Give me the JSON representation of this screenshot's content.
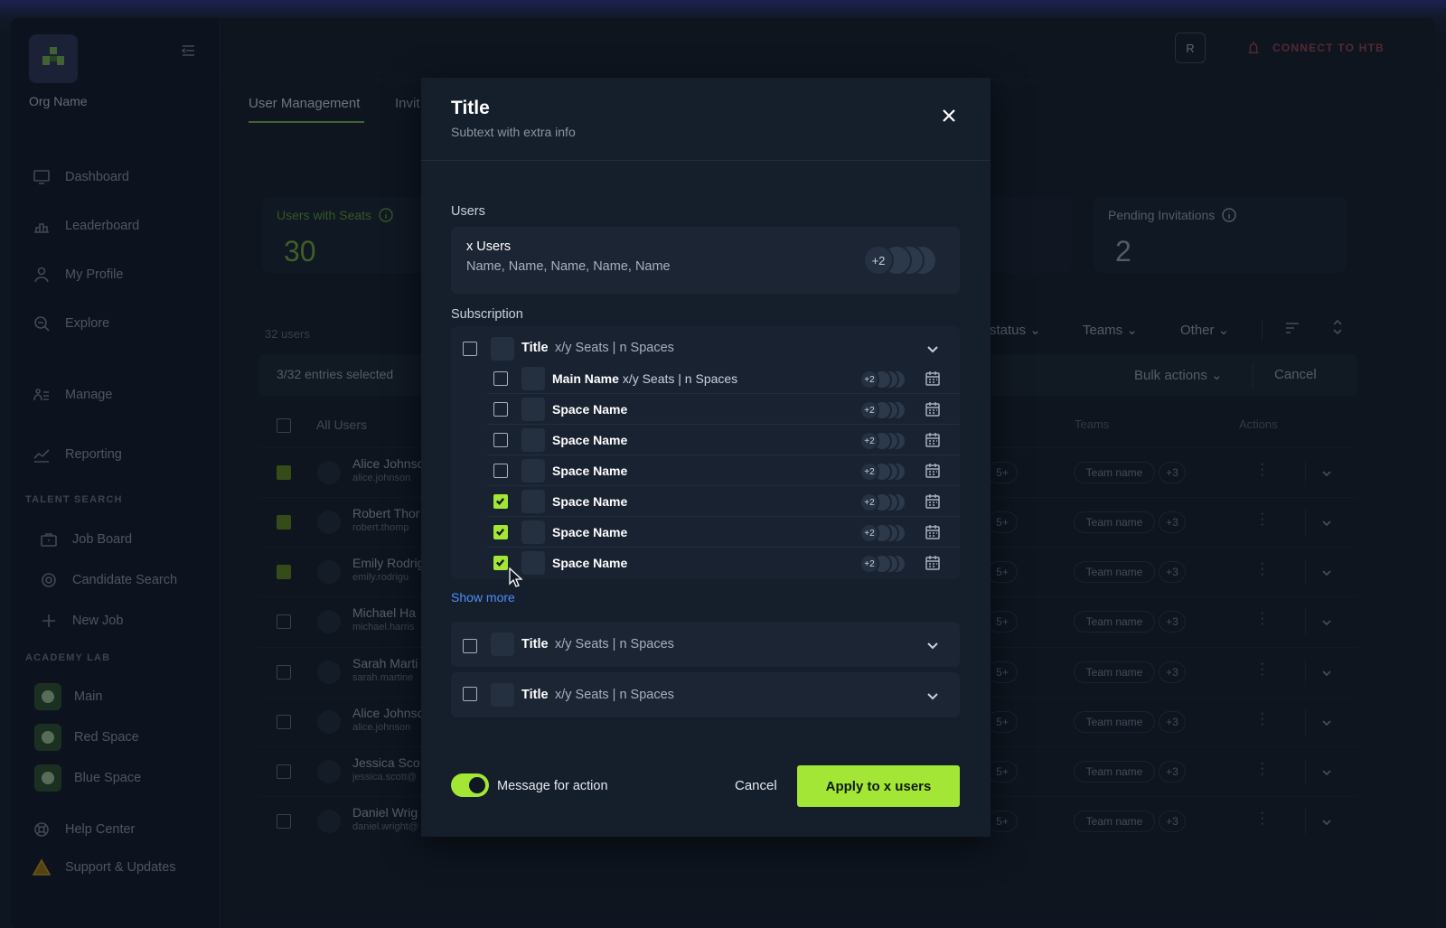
{
  "sidebar": {
    "org_name": "Org Name",
    "nav": [
      {
        "label": "Dashboard",
        "icon": "monitor-icon"
      },
      {
        "label": "Leaderboard",
        "icon": "podium-icon"
      },
      {
        "label": "My Profile",
        "icon": "user-icon"
      },
      {
        "label": "Explore",
        "icon": "explore-icon"
      },
      {
        "label": "Manage",
        "icon": "manage-icon"
      },
      {
        "label": "Reporting",
        "icon": "chart-icon"
      }
    ],
    "talent_label": "TALENT SEARCH",
    "talent": [
      {
        "label": "Job Board",
        "icon": "briefcase-icon"
      },
      {
        "label": "Candidate Search",
        "icon": "target-icon"
      },
      {
        "label": "New Job",
        "icon": "plus-icon"
      }
    ],
    "academy_label": "ACADEMY LAB",
    "spaces": [
      {
        "label": "Main"
      },
      {
        "label": "Red Space"
      },
      {
        "label": "Blue Space"
      }
    ],
    "help": "Help Center",
    "support": "Support & Updates"
  },
  "header": {
    "avatar_letter": "R",
    "connect": "CONNECT TO HTB"
  },
  "tabs": [
    {
      "label": "User Management"
    },
    {
      "label": "Invit"
    }
  ],
  "stats": [
    {
      "label": "Users with Seats",
      "value": "30"
    },
    {
      "label": "Pending Invitations",
      "value": "2"
    }
  ],
  "list": {
    "count": "32 users",
    "selected": "3/32 entries selected",
    "bulk_actions": "Bulk actions",
    "cancel": "Cancel",
    "filters": [
      "status",
      "Teams",
      "Other"
    ],
    "col_all": "All Users",
    "col_teams": "Teams",
    "col_actions": "Actions",
    "rows": [
      {
        "name": "Alice Johnso",
        "email": "alice.johnson",
        "checked": true,
        "team": "Team name",
        "extra": "+3",
        "more": "5+"
      },
      {
        "name": "Robert Thor",
        "email": "robert.thomp",
        "checked": true,
        "team": "Team name",
        "extra": "+3",
        "more": "5+"
      },
      {
        "name": "Emily Rodrig",
        "email": "emily.rodrigu",
        "checked": true,
        "team": "Team name",
        "extra": "+3",
        "more": "5+"
      },
      {
        "name": "Michael Ha",
        "email": "michael.harris",
        "checked": false,
        "team": "Team name",
        "extra": "+3",
        "more": "5+"
      },
      {
        "name": "Sarah Marti",
        "email": "sarah.martine",
        "checked": false,
        "team": "Team name",
        "extra": "+3",
        "more": "5+"
      },
      {
        "name": "Alice Johnso",
        "email": "alice.johnson",
        "checked": false,
        "team": "Team name",
        "extra": "+3",
        "more": "5+"
      },
      {
        "name": "Jessica Sco",
        "email": "jessica.scott@",
        "checked": false,
        "team": "Team name",
        "extra": "+3",
        "more": "5+"
      },
      {
        "name": "Daniel Wrig",
        "email": "daniel.wright@",
        "checked": false,
        "team": "Team name",
        "extra": "+3",
        "more": "5+"
      }
    ]
  },
  "modal": {
    "title": "Title",
    "subtitle": "Subtext with extra info",
    "users_label": "Users",
    "users_title": "x Users",
    "users_names": "Name, Name, Name, Name, Name",
    "users_extra": "+2",
    "subscription_label": "Subscription",
    "group_title": "Title",
    "group_meta": "x/y Seats | n Spaces",
    "main_space": {
      "name": "Main Name",
      "meta": "x/y Seats | n Spaces",
      "extra": "+2",
      "checked": false
    },
    "spaces": [
      {
        "name": "Space Name",
        "extra": "+2",
        "checked": false
      },
      {
        "name": "Space Name",
        "extra": "+2",
        "checked": false
      },
      {
        "name": "Space Name",
        "extra": "+2",
        "checked": false
      },
      {
        "name": "Space Name",
        "extra": "+2",
        "checked": true
      },
      {
        "name": "Space Name",
        "extra": "+2",
        "checked": true
      },
      {
        "name": "Space Name",
        "extra": "+2",
        "checked": true
      }
    ],
    "show_more": "Show more",
    "other_groups": [
      {
        "title": "Title",
        "meta": "x/y Seats | n Spaces"
      },
      {
        "title": "Title",
        "meta": "x/y Seats | n Spaces"
      }
    ],
    "toggle_on": true,
    "toggle_label": "Message for action",
    "cancel": "Cancel",
    "apply": "Apply to x users"
  },
  "colors": {
    "accent": "#a3e635",
    "link": "#4f8ef7",
    "danger": "#8a3e4b"
  }
}
